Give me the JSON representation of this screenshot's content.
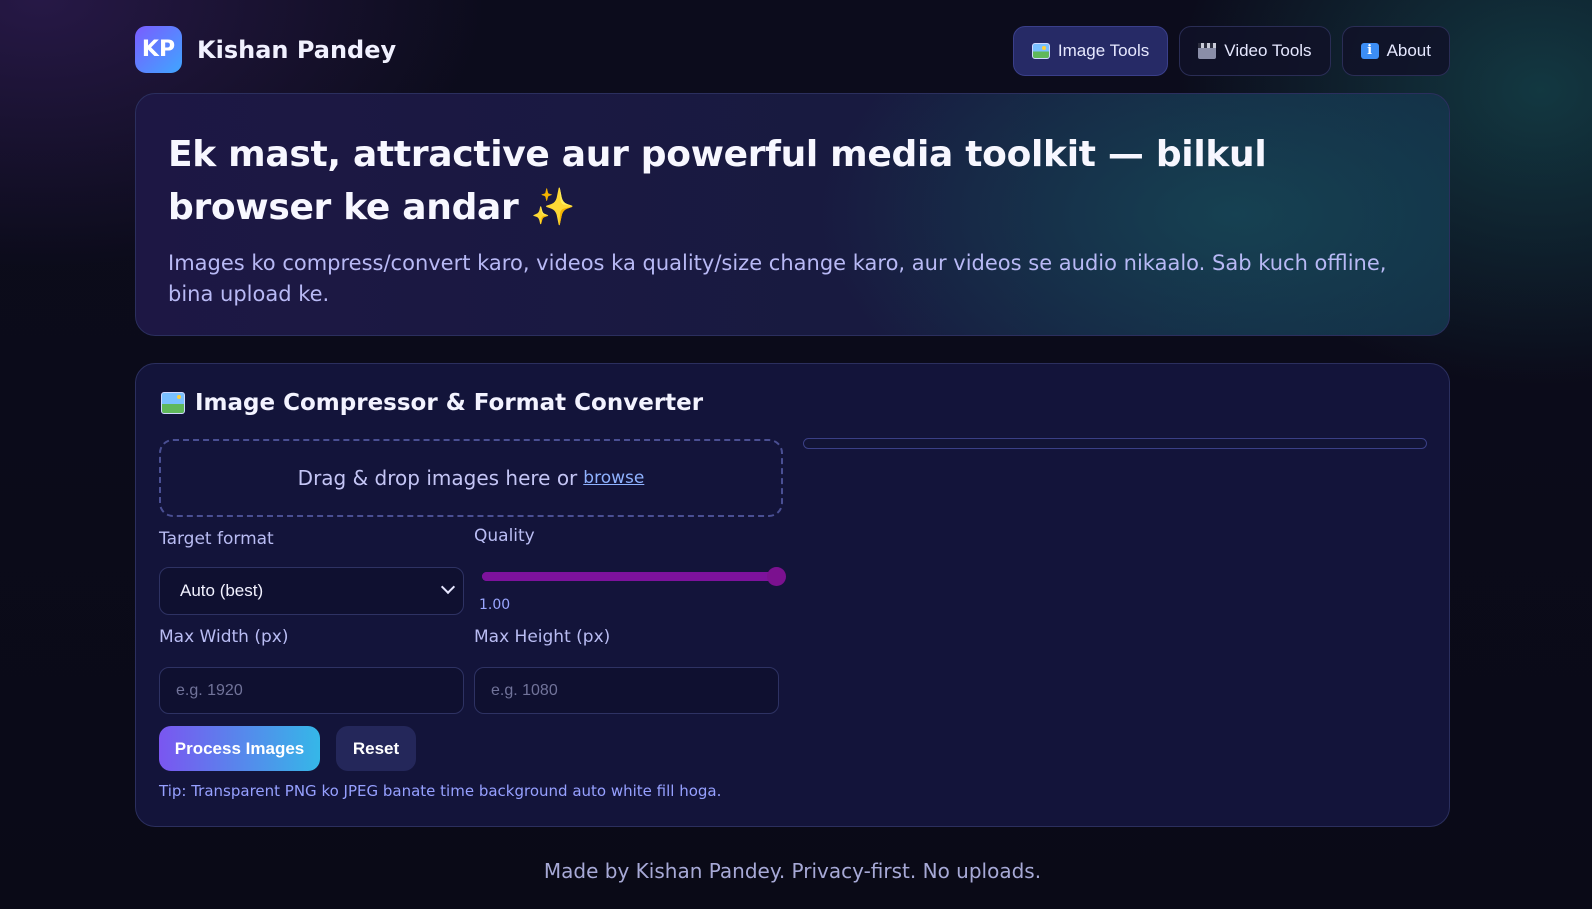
{
  "brand": {
    "logo_text": "KP",
    "name": "Kishan Pandey"
  },
  "nav": {
    "items": [
      {
        "icon": "image-icon",
        "label": "Image Tools",
        "active": true
      },
      {
        "icon": "clapper-icon",
        "label": "Video Tools",
        "active": false
      },
      {
        "icon": "info-icon",
        "label": "About",
        "active": false
      }
    ]
  },
  "hero": {
    "title": "Ek mast, attractive aur powerful media toolkit — bilkul browser ke andar",
    "sparkle": "✨",
    "subtitle": "Images ko compress/convert karo, videos ka quality/size change karo, aur videos se audio nikaalo. Sab kuch offline, bina upload ke."
  },
  "image_tool": {
    "title": "Image Compressor & Format Converter",
    "dropzone": {
      "text": "Drag & drop images here or",
      "link": "browse"
    },
    "progress": 0,
    "format": {
      "label": "Target format",
      "selected": "Auto (best)"
    },
    "quality": {
      "label": "Quality",
      "value": 1.0,
      "display": "1.00"
    },
    "max_width": {
      "label": "Max Width (px)",
      "placeholder": "e.g. 1920",
      "value": ""
    },
    "max_height": {
      "label": "Max Height (px)",
      "placeholder": "e.g. 1080",
      "value": ""
    },
    "process_label": "Process Images",
    "reset_label": "Reset",
    "tip": "Tip: Transparent PNG ko JPEG banate time background auto white fill hoga."
  },
  "footer": {
    "text": "Made by Kishan Pandey. Privacy-first. No uploads."
  },
  "colors": {
    "accent_start": "#7a56f0",
    "accent_end": "#35b7e8",
    "slider": "#7b118f"
  }
}
